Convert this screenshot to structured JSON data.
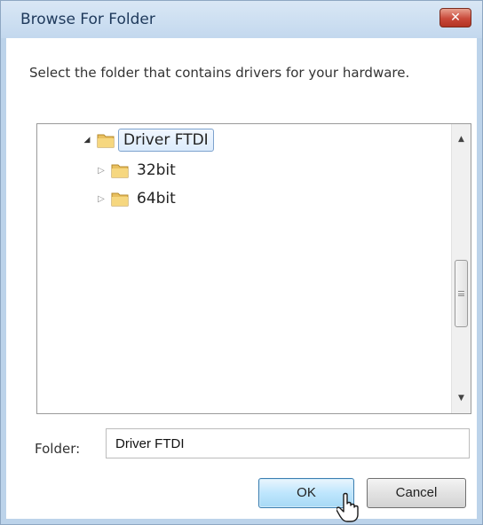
{
  "window": {
    "title": "Browse For Folder",
    "close_glyph": "✕"
  },
  "description": "Select the folder that contains drivers for your hardware.",
  "tree": {
    "nodes": [
      {
        "label": "Driver FTDI",
        "expander": "◢",
        "icon": "folder-icon",
        "selected": true
      },
      {
        "label": "32bit",
        "expander": "▷",
        "icon": "folder-icon",
        "selected": false
      },
      {
        "label": "64bit",
        "expander": "▷",
        "icon": "folder-icon",
        "selected": false
      }
    ],
    "scrollbar": {
      "up": "▲",
      "down": "▼"
    }
  },
  "folder": {
    "label": "Folder:",
    "value": "Driver FTDI"
  },
  "buttons": {
    "ok": "OK",
    "cancel": "Cancel"
  },
  "colors": {
    "title_bar": "#c3d8ee",
    "close_button": "#c9493a",
    "selection": "#dcebfc",
    "ok_button": "#bee6fd"
  }
}
